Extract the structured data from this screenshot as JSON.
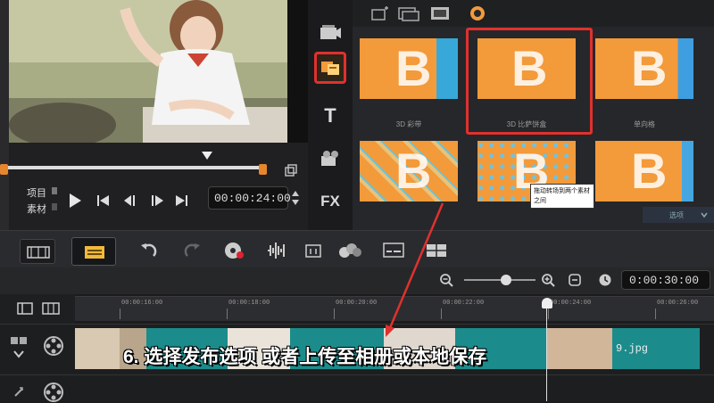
{
  "preview": {
    "project_label": "项目",
    "clip_label": "素材",
    "timecode": "00:00:24:00"
  },
  "library": {
    "tools": [
      "fx-add-icon",
      "folder-icon",
      "gallery-icon",
      "sort-icon"
    ],
    "transitions": [
      {
        "label": "3D 彩带",
        "selected": false
      },
      {
        "label": "3D 比萨饼盒",
        "selected": true
      },
      {
        "label": "单向格",
        "selected": false
      },
      {
        "label": "",
        "selected": false
      },
      {
        "label": "",
        "selected": false
      },
      {
        "label": "",
        "selected": false
      }
    ],
    "tooltip": "拖动转场到两个素材之间",
    "bottom_label": "选项"
  },
  "side_menu": {
    "items": [
      {
        "name": "media-icon",
        "label": ""
      },
      {
        "name": "transition-icon",
        "label": ""
      },
      {
        "name": "title-icon",
        "label": "T"
      },
      {
        "name": "graphic-icon",
        "label": ""
      },
      {
        "name": "filter-icon",
        "label": "FX"
      }
    ]
  },
  "timeline": {
    "duration": "0:00:30:00",
    "ticks": [
      "00:00:16:00",
      "00:00:18:00",
      "00:00:20:00",
      "00:00:22:00",
      "00:00:24:00",
      "00:00:26:00"
    ],
    "clip_name": "9.jpg",
    "subtitle": "6. 选择发布选项 或者上传至相册或本地保存"
  },
  "colors": {
    "accent_orange": "#f39a3a",
    "highlight_red": "#e0312e",
    "clip_teal": "#1b8c8b"
  }
}
